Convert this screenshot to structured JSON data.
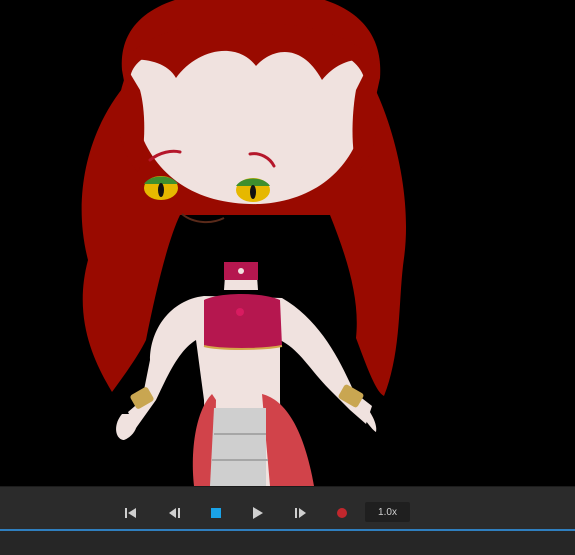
{
  "player": {
    "speed_label": "1.0x"
  },
  "colors": {
    "background": "#000000",
    "controls_bar": "#2b2b2b",
    "timeline_accent": "#2f7fbf",
    "stop_blue": "#1aa3e8",
    "record_red": "#c1272d",
    "hair": "#990a00",
    "skin": "#f0e2df",
    "top": "#b5174f"
  },
  "controls": [
    {
      "name": "skip-to-start-button",
      "icon": "skip-to-start-icon"
    },
    {
      "name": "step-back-button",
      "icon": "step-back-icon"
    },
    {
      "name": "stop-button",
      "icon": "stop-icon"
    },
    {
      "name": "play-button",
      "icon": "play-icon"
    },
    {
      "name": "step-forward-button",
      "icon": "step-forward-icon"
    },
    {
      "name": "record-button",
      "icon": "record-icon"
    }
  ]
}
